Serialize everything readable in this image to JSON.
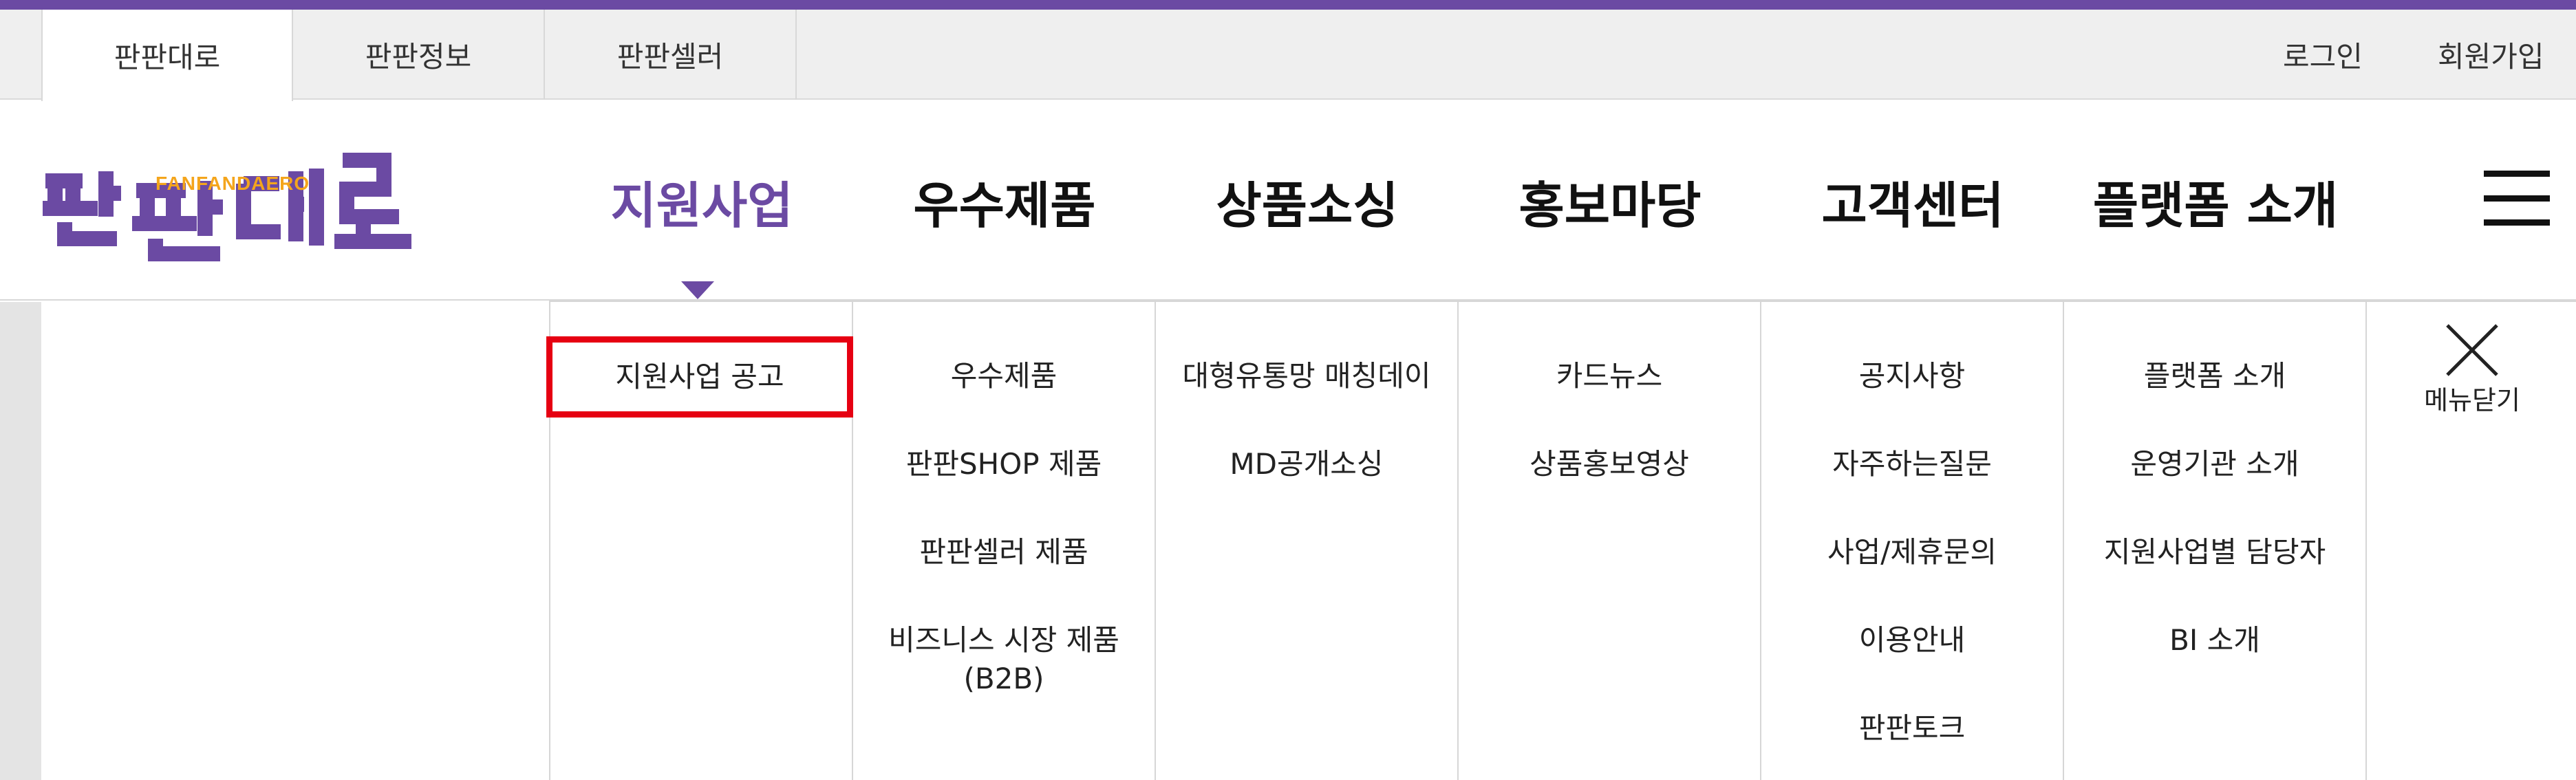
{
  "utility_bar": {
    "tabs": [
      {
        "label": "판판대로",
        "active": true
      },
      {
        "label": "판판정보",
        "active": false
      },
      {
        "label": "판판셀러",
        "active": false
      }
    ],
    "login": "로그인",
    "signup": "회원가입"
  },
  "header": {
    "logo": {
      "english": "FANFANDAERO",
      "korean": "판판대로"
    },
    "nav": [
      {
        "label": "지원사업",
        "active": true
      },
      {
        "label": "우수제품",
        "active": false
      },
      {
        "label": "상품소싱",
        "active": false
      },
      {
        "label": "홍보마당",
        "active": false
      },
      {
        "label": "고객센터",
        "active": false
      },
      {
        "label": "플랫폼 소개",
        "active": false
      }
    ],
    "menu_icon": "hamburger-icon"
  },
  "mega_menu": {
    "columns": [
      {
        "items": [
          "지원사업 공고"
        ]
      },
      {
        "items": [
          "우수제품",
          "판판SHOP 제품",
          "판판셀러 제품",
          "비즈니스 시장 제품\n(B2B)"
        ]
      },
      {
        "items": [
          "대형유통망 매칭데이",
          "MD공개소싱"
        ]
      },
      {
        "items": [
          "카드뉴스",
          "상품홍보영상"
        ]
      },
      {
        "items": [
          "공지사항",
          "자주하는질문",
          "사업/제휴문의",
          "이용안내",
          "판판토크"
        ]
      },
      {
        "items": [
          "플랫폼 소개",
          "운영기관 소개",
          "지원사업별 담당자",
          "BI 소개"
        ]
      }
    ],
    "close_label": "메뉴닫기",
    "close_icon": "close-icon"
  },
  "colors": {
    "accent": "#6b4aa3",
    "logo_orange": "#f4a51c",
    "highlight_border": "#e60012"
  }
}
